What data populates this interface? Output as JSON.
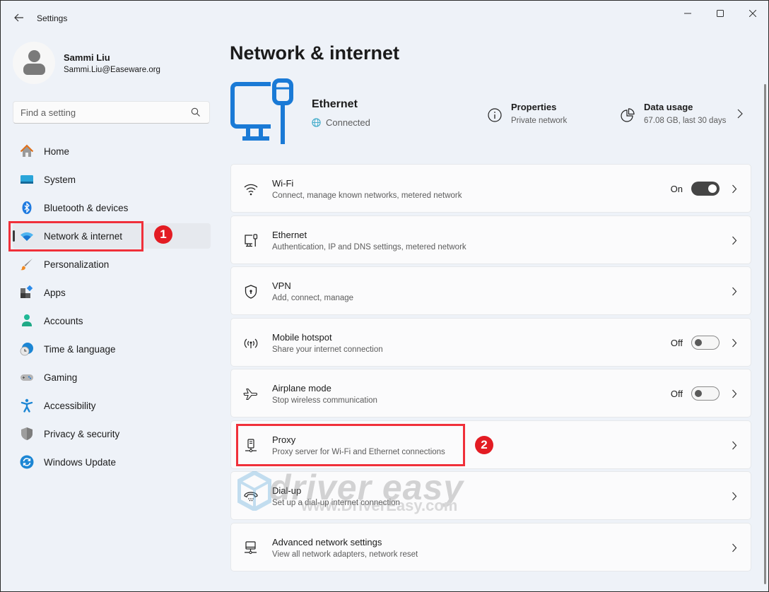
{
  "window": {
    "title": "Settings",
    "back_icon": "arrow-left-icon",
    "controls": {
      "minimize": "minimize-icon",
      "maximize": "maximize-icon",
      "close": "close-icon"
    }
  },
  "profile": {
    "name": "Sammi Liu",
    "email": "Sammi.Liu@Easeware.org"
  },
  "search": {
    "placeholder": "Find a setting",
    "value": ""
  },
  "sidebar": {
    "items": [
      {
        "label": "Home",
        "icon": "home-icon"
      },
      {
        "label": "System",
        "icon": "system-icon"
      },
      {
        "label": "Bluetooth & devices",
        "icon": "bluetooth-icon"
      },
      {
        "label": "Network & internet",
        "icon": "wifi-icon",
        "active": true
      },
      {
        "label": "Personalization",
        "icon": "brush-icon"
      },
      {
        "label": "Apps",
        "icon": "apps-icon"
      },
      {
        "label": "Accounts",
        "icon": "accounts-icon"
      },
      {
        "label": "Time & language",
        "icon": "time-language-icon"
      },
      {
        "label": "Gaming",
        "icon": "gamepad-icon"
      },
      {
        "label": "Accessibility",
        "icon": "accessibility-icon"
      },
      {
        "label": "Privacy & security",
        "icon": "shield-icon"
      },
      {
        "label": "Windows Update",
        "icon": "update-icon"
      }
    ]
  },
  "annotations": {
    "step1": "1",
    "step2": "2",
    "color": "#e31c23"
  },
  "main": {
    "title": "Network & internet",
    "connection": {
      "name": "Ethernet",
      "status": "Connected",
      "properties_title": "Properties",
      "properties_sub": "Private network",
      "data_usage_title": "Data usage",
      "data_usage_sub": "67.08 GB, last 30 days"
    },
    "rows": [
      {
        "title": "Wi-Fi",
        "subtitle": "Connect, manage known networks, metered network",
        "icon": "wifi-icon",
        "state": "On",
        "toggle": true
      },
      {
        "title": "Ethernet",
        "subtitle": "Authentication, IP and DNS settings, metered network",
        "icon": "ethernet-icon"
      },
      {
        "title": "VPN",
        "subtitle": "Add, connect, manage",
        "icon": "vpn-shield-icon"
      },
      {
        "title": "Mobile hotspot",
        "subtitle": "Share your internet connection",
        "icon": "hotspot-icon",
        "state": "Off",
        "toggle": false
      },
      {
        "title": "Airplane mode",
        "subtitle": "Stop wireless communication",
        "icon": "airplane-icon",
        "state": "Off",
        "toggle": false
      },
      {
        "title": "Proxy",
        "subtitle": "Proxy server for Wi-Fi and Ethernet connections",
        "icon": "proxy-icon"
      },
      {
        "title": "Dial-up",
        "subtitle": "Set up a dial-up internet connection",
        "icon": "dialup-phone-icon"
      },
      {
        "title": "Advanced network settings",
        "subtitle": "View all network adapters, network reset",
        "icon": "network-adapter-icon"
      }
    ]
  },
  "watermark": {
    "brand": "driver easy",
    "url": "www.DriverEasy.com"
  },
  "colors": {
    "accent": "#0f6cbd",
    "background": "#eef2f8",
    "card": "#fbfbfc",
    "toggle_on": "#454545"
  }
}
